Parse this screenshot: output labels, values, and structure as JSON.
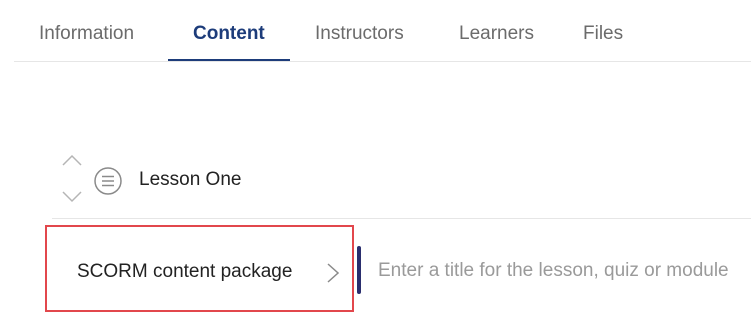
{
  "tabs": [
    {
      "label": "Information",
      "active": false
    },
    {
      "label": "Content",
      "active": true
    },
    {
      "label": "Instructors",
      "active": false
    },
    {
      "label": "Learners",
      "active": false
    },
    {
      "label": "Files",
      "active": false
    }
  ],
  "lesson": {
    "title": "Lesson One",
    "icons": {
      "up": "chevron-up-icon",
      "down": "chevron-down-icon",
      "type": "list-icon"
    }
  },
  "new_item": {
    "type_label": "SCORM content package",
    "type_icon": "chevron-right-icon",
    "title_placeholder": "Enter a title for the lesson, quiz or module",
    "title_value": ""
  },
  "colors": {
    "accent": "#1d3c7a",
    "highlight_border": "#e2474c",
    "caret": "#2a2e6e",
    "muted_text": "#6b6b6b"
  }
}
